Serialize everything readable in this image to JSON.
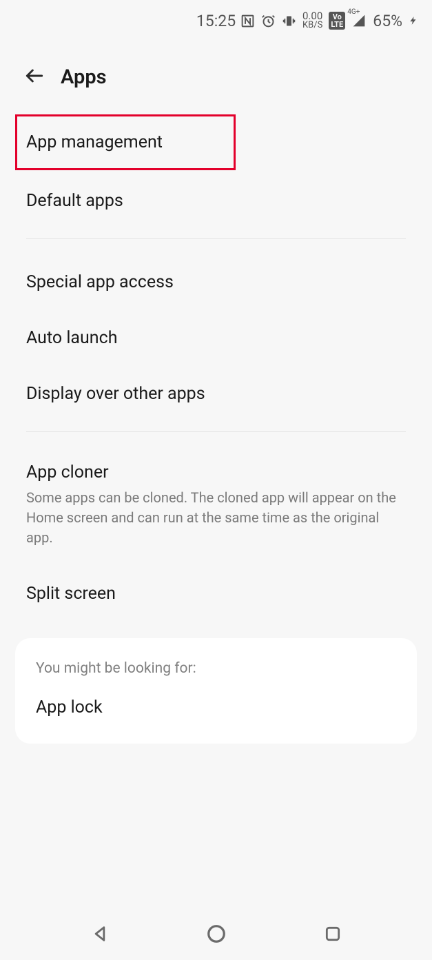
{
  "status": {
    "time": "15:25",
    "data_rate_value": "0.00",
    "data_rate_unit": "KB/S",
    "lte_top": "Vo",
    "lte_bottom": "LTE",
    "network_label": "4G+",
    "battery_pct": "65%"
  },
  "header": {
    "title": "Apps"
  },
  "rows": {
    "app_management": "App management",
    "default_apps": "Default apps",
    "special_app_access": "Special app access",
    "auto_launch": "Auto launch",
    "display_over": "Display over other apps",
    "app_cloner": "App cloner",
    "app_cloner_sub": "Some apps can be cloned. The cloned app will appear on the Home screen and can run at the same time as the original app.",
    "split_screen": "Split screen"
  },
  "suggestion": {
    "hint": "You might be looking for:",
    "item": "App lock"
  }
}
